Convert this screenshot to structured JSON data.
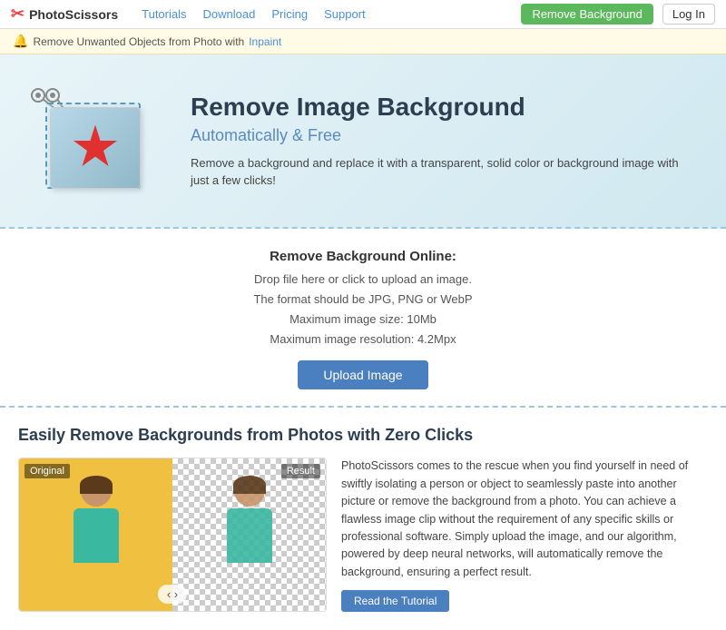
{
  "navbar": {
    "logo_text": "PhotoScissors",
    "links": [
      {
        "label": "Tutorials",
        "href": "#"
      },
      {
        "label": "Download",
        "href": "#"
      },
      {
        "label": "Pricing",
        "href": "#"
      },
      {
        "label": "Support",
        "href": "#"
      }
    ],
    "btn_remove_bg": "Remove Background",
    "btn_login": "Log In"
  },
  "notice_bar": {
    "icon": "🔔",
    "text": "Remove Unwanted Objects from Photo with",
    "link_text": "Inpaint"
  },
  "hero": {
    "title": "Remove Image Background",
    "subtitle": "Automatically & Free",
    "description": "Remove a background and replace it with a transparent, solid color or background image with just a few clicks!"
  },
  "upload_section": {
    "title": "Remove Background Online:",
    "hint_line1": "Drop file here or click to upload an image.",
    "hint_line2": "The format should be JPG, PNG or WebP",
    "hint_line3": "Maximum image size: 10Mb",
    "hint_line4": "Maximum image resolution: 4.2Mpx",
    "btn_label": "Upload Image"
  },
  "lower_section": {
    "title": "Easily Remove Backgrounds from Photos with Zero Clicks",
    "label_original": "Original",
    "label_result": "Result",
    "nav_arrows": "‹ ›",
    "description": "PhotoScissors comes to the rescue when you find yourself in need of swiftly isolating a person or object to seamlessly paste into another picture or remove the background from a photo. You can achieve a flawless image clip without the requirement of any specific skills or professional software. Simply upload the image, and our algorithm, powered by deep neural networks, will automatically remove the background, ensuring a perfect result.",
    "btn_tutorial": "Read the Tutorial"
  }
}
